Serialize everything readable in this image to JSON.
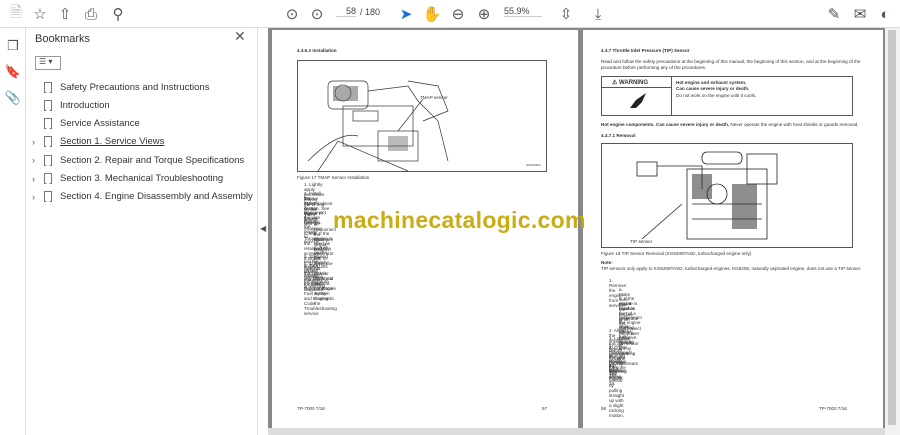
{
  "toolbar": {
    "page_current": "58",
    "page_total": "/ 180",
    "zoom": "55.9%"
  },
  "bookmarks": {
    "title": "Bookmarks",
    "items": [
      {
        "label": "Safety Precautions and Instructions",
        "expandable": false
      },
      {
        "label": "Introduction",
        "expandable": false
      },
      {
        "label": "Service Assistance",
        "expandable": false
      },
      {
        "label": "Section 1. Service Views",
        "expandable": true
      },
      {
        "label": "Section 2. Repair and Torque Specifications",
        "expandable": true
      },
      {
        "label": "Section 3. Mechanical Troubleshooting",
        "expandable": true
      },
      {
        "label": "Section 4. Engine Disassembly and Assembly",
        "expandable": true
      }
    ]
  },
  "watermark": "machinecatalogic.com",
  "left_page": {
    "heading": "4.3.6.2     Installation",
    "callout": "TMAP sensor",
    "fig_code": "GM116102",
    "caption": "Figure 17     TMAP Sensor Installation",
    "steps": [
      "1.   Lightly apply petroleum jelly to the O-ring on the TMAP sensor.",
      "2.   Install the TMAP sensor and secure with the retaining screw. Torque the retaining screw to 8 Nm (7 ft. lb.). Refer to the",
      "      Torque Specifications section. See Figure 17.",
      "3.   Reconnect the wire harness.",
      "4.   Return the engine to service:",
      "a.   Reconnect the battery.",
      "b.   If the engine is used as part of a generator set, re-apply the AC power supply to the generator set by closing the",
      "      upstream circuit breaker.",
      "c.   Turn on the fuel supply.",
      "5.   Start and run the engine until normal operating temperature is reached.",
      "6.   Turn off the engine.",
      "7.   Check for any DTCs and troubleshoot. Refer to Engine Fuel System and Diagnostic Code Troubleshooting service",
      "      manual for further diagnosis."
    ],
    "footer_left": "TP-7000      7/16",
    "footer_right": "57"
  },
  "right_page": {
    "heading": "4.3.7     Throttle Inlet Pressure (TIP) Sensor",
    "intro1": "Read and follow the safety precautions at the beginning of this manual, the beginning of this section, and at the beginning of the",
    "intro2": "procedure before performing any of the procedures.",
    "warning_label": "WARNING",
    "warn1": "Hot engine and exhaust system.",
    "warn2": "Can cause severe injury or death.",
    "warn3": "Do not work on the engine until it cools.",
    "hot_bold": "Hot engine components. Can cause severe injury or death.",
    "hot_rest": " Never operate the engine with heat shields or guards removed.",
    "sub": "4.3.7.1     Removal",
    "callout": "TIP sensor",
    "caption": "Figure 18     TIP Sensor Removal (KG6208TASD, turbocharged engine only)",
    "note_label": "Note:",
    "note": "TIP sensors only apply to KG6208TASD, turbocharged engines. KG6208, naturally aspirated engine, does not use a TIP sensor.",
    "steps": [
      "1.   Remove the engine from service.",
      "a.   Make sure that the engine is off.",
      "b.   If the engine is used as part of a generator set, disconnect AC power to the generator set by opening the upstream",
      "      circuit breaker.",
      "c.   Disconnect the engine starting battery, negative (-) lead first.",
      "d.   Shut off the fuel supply.",
      "2.   Allow the engine to cool before working on the TIP sensor.",
      "3.   Locate the TIP sensor upstream of the throttle body. See Figure 18.",
      "4.   Disconnect the wire harness from the TIP sensor.",
      "5.   Remove the retaining screw.",
      "6.   Remove TIP sensor by pulling straight up with a slight rocking motion."
    ],
    "footer_left": "58",
    "footer_right": "TP-7000      7/16"
  }
}
